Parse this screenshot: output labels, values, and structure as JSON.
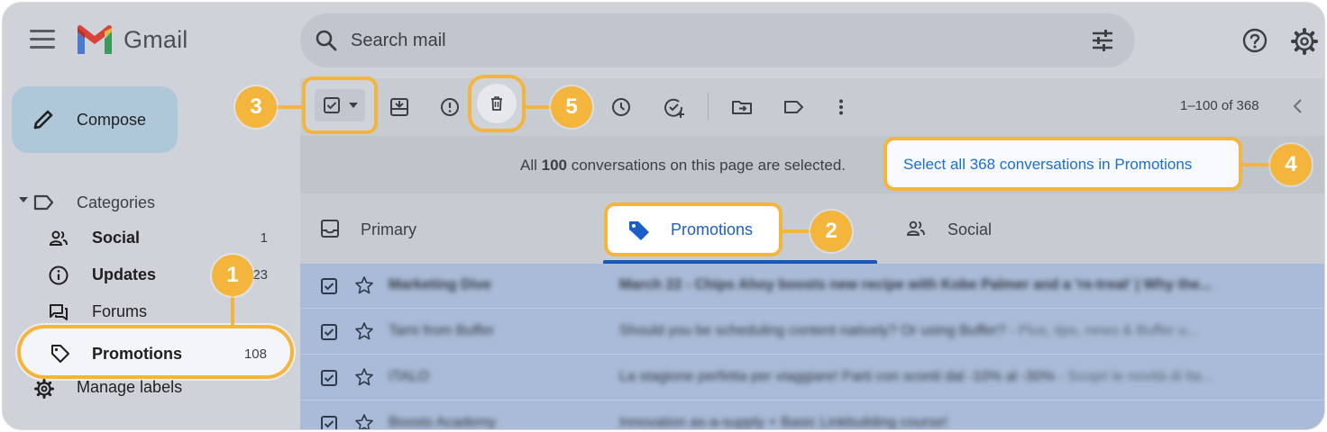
{
  "app": {
    "name": "Gmail"
  },
  "search": {
    "placeholder": "Search mail"
  },
  "compose": {
    "label": "Compose"
  },
  "sidebar": {
    "categories_label": "Categories",
    "items": [
      {
        "name": "Social",
        "count": "1"
      },
      {
        "name": "Updates",
        "count": "23"
      },
      {
        "name": "Forums",
        "count": ""
      },
      {
        "name": "Promotions",
        "count": "108"
      }
    ],
    "manage_labels": "Manage labels"
  },
  "toolbar": {
    "pager": "1–100 of 368"
  },
  "selection_banner": {
    "message_pre": "All ",
    "message_count": "100",
    "message_post": " conversations on this page are selected.",
    "select_all_link": "Select all 368 conversations in Promotions"
  },
  "tabs": [
    {
      "label": "Primary"
    },
    {
      "label": "Promotions"
    },
    {
      "label": "Social"
    }
  ],
  "rows": [
    {
      "sender": "Marketing Dive",
      "subject": "March 22 - Chips Ahoy boosts new recipe with Kobe Palmer and a 're-treat' | Why the...",
      "snippet": ""
    },
    {
      "sender": "Tami from Buffer",
      "subject": "Should you be scheduling content natively? Or using Buffer?",
      "snippet": " - Plus, tips, news & Buffer u..."
    },
    {
      "sender": "ITALO",
      "subject": "La stagione perfetta per viaggiare! Parti con sconti dal -10% al -30%",
      "snippet": " - Scopri le novità di Ita..."
    },
    {
      "sender": "Boosts Academy",
      "subject": "Innovation as-a-supply + Basic Linkbuilding course!",
      "snippet": ""
    }
  ],
  "callouts": [
    "1",
    "2",
    "3",
    "4",
    "5"
  ],
  "colors": {
    "accent": "#f4b53c",
    "link": "#1a6fd1",
    "selected_row": "#a9bbd8",
    "compose": "#aec7d9"
  }
}
